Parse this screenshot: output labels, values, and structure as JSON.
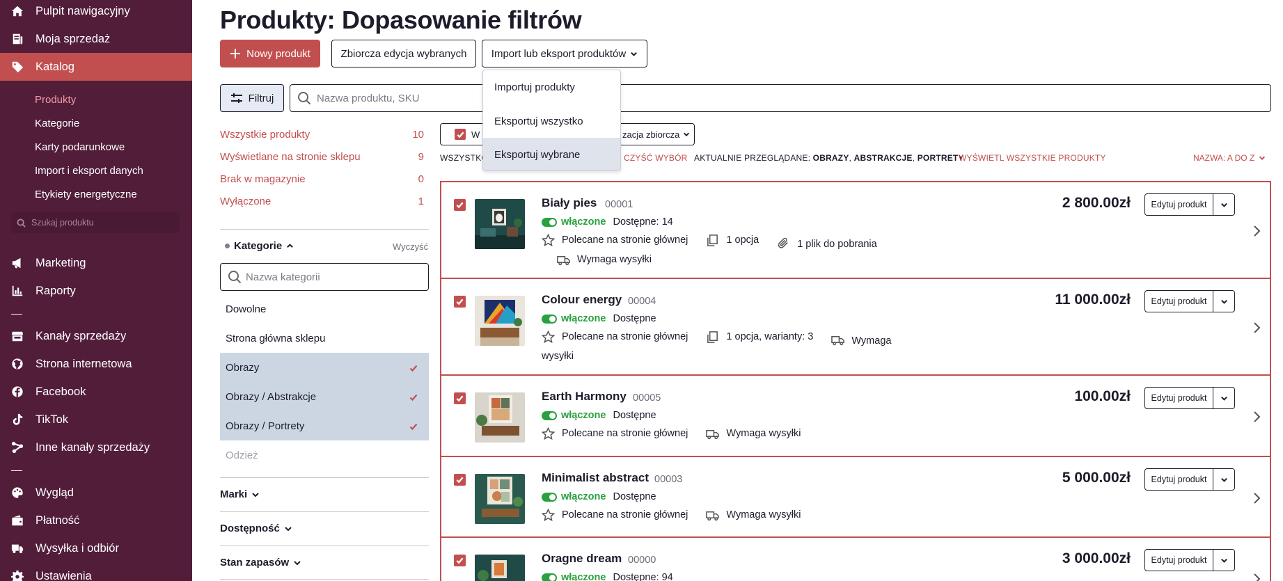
{
  "sidebar": {
    "top_items": [
      {
        "label": "Pulpit nawigacyjny",
        "icon": "home-icon"
      },
      {
        "label": "Moja sprzedaż",
        "icon": "receipt-icon"
      },
      {
        "label": "Katalog",
        "icon": "tag-icon"
      }
    ],
    "catalog_sub": [
      "Produkty",
      "Kategorie",
      "Karty podarunkowe",
      "Import i eksport danych",
      "Etykiety energetyczne"
    ],
    "search_placeholder": "Szukaj produktu",
    "mid_items": [
      {
        "label": "Marketing",
        "icon": "megaphone-icon"
      },
      {
        "label": "Raporty",
        "icon": "bar-chart-icon"
      }
    ],
    "channel_items": [
      {
        "label": "Kanały sprzedaży",
        "icon": "store-icon"
      },
      {
        "label": "Strona internetowa",
        "icon": "globe-icon"
      },
      {
        "label": "Facebook",
        "icon": "facebook-icon"
      },
      {
        "label": "TikTok",
        "icon": "tiktok-icon"
      },
      {
        "label": "Inne kanały sprzedaży",
        "icon": "share-icon"
      }
    ],
    "bottom_items": [
      {
        "label": "Wygląd",
        "icon": "palette-icon"
      },
      {
        "label": "Płatność",
        "icon": "wallet-icon"
      },
      {
        "label": "Wysyłka i odbiór",
        "icon": "truck-icon"
      },
      {
        "label": "Ustawienia",
        "icon": "gear-icon"
      }
    ]
  },
  "header": {
    "title": "Produkty: Dopasowanie filtrów",
    "new_product": "Nowy produkt",
    "bulk_edit": "Zbiorcza edycja wybranych",
    "import_export": "Import lub eksport produktów"
  },
  "dropdown": [
    "Importuj produkty",
    "Eksportuj wszystko",
    "Eksportuj wybrane"
  ],
  "filter": {
    "button": "Filtruj",
    "search_placeholder": "Nazwa produktu, SKU",
    "counts": [
      {
        "label": "Wszystkie produkty",
        "count": "10"
      },
      {
        "label": "Wyświetlane na stronie sklepu",
        "count": "9"
      },
      {
        "label": "Brak w magazynie",
        "count": "0"
      },
      {
        "label": "Wyłączone",
        "count": "1"
      }
    ],
    "categories_title": "Kategorie",
    "clear": "Wyczyść",
    "category_search_placeholder": "Nazwa kategorii",
    "categories": [
      {
        "label": "Dowolne",
        "selected": false
      },
      {
        "label": "Strona główna sklepu",
        "selected": false
      },
      {
        "label": "Obrazy",
        "selected": true
      },
      {
        "label": "Obrazy / Abstrakcje",
        "selected": true
      },
      {
        "label": "Obrazy / Portrety",
        "selected": true
      },
      {
        "label": "Odzież",
        "selected": false
      }
    ],
    "facets": [
      "Marki",
      "Dostępność",
      "Stan zapasów"
    ]
  },
  "toolbar": {
    "select_label": "W",
    "bulk_action_label": "zacja zbiorcza",
    "all_label": "WSZYSTKO",
    "clear_selection": "CZYŚĆ WYBÓR",
    "viewing_prefix": "AKTUALNIE PRZEGLĄDANE:",
    "viewing_a": "OBRAZY",
    "viewing_b": "ABSTRAKCJE",
    "viewing_c": "PORTRETY",
    "show_all": "WYŚWIETL WSZYSTKIE PRODUKTY",
    "sort": "NAZWA: A DO Z"
  },
  "products": [
    {
      "name": "Biały pies",
      "sku": "00001",
      "status": "włączone",
      "availability": "Dostępne: 14",
      "featured": "Polecane na stronie głównej",
      "options": "1 opcja",
      "files": "1 plik do pobrania",
      "shipping": "Wymaga wysyłki",
      "price": "2 800.00zł",
      "edit": "Edytuj produkt"
    },
    {
      "name": "Colour energy",
      "sku": "00004",
      "status": "włączone",
      "availability": "Dostępne",
      "featured": "Polecane na stronie głównej",
      "options": "1 opcja, warianty: 3",
      "shipping": "Wymaga wysyłki",
      "price": "11 000.00zł",
      "edit": "Edytuj produkt"
    },
    {
      "name": "Earth Harmony",
      "sku": "00005",
      "status": "włączone",
      "availability": "Dostępne",
      "featured": "Polecane na stronie głównej",
      "shipping": "Wymaga wysyłki",
      "price": "100.00zł",
      "edit": "Edytuj produkt"
    },
    {
      "name": "Minimalist abstract",
      "sku": "00003",
      "status": "włączone",
      "availability": "Dostępne",
      "featured": "Polecane na stronie głównej",
      "shipping": "Wymaga wysyłki",
      "price": "5 000.00zł",
      "edit": "Edytuj produkt"
    },
    {
      "name": "Oragne dream",
      "sku": "00000",
      "status": "włączone",
      "availability": "Dostępne: 94",
      "price": "3 000.00zł",
      "edit": "Edytuj produkt"
    }
  ],
  "colors": {
    "sidebar": "#511d39",
    "accent": "#c24f4f",
    "enabled": "#2aa140",
    "selected_row": "#ccd6e3"
  }
}
